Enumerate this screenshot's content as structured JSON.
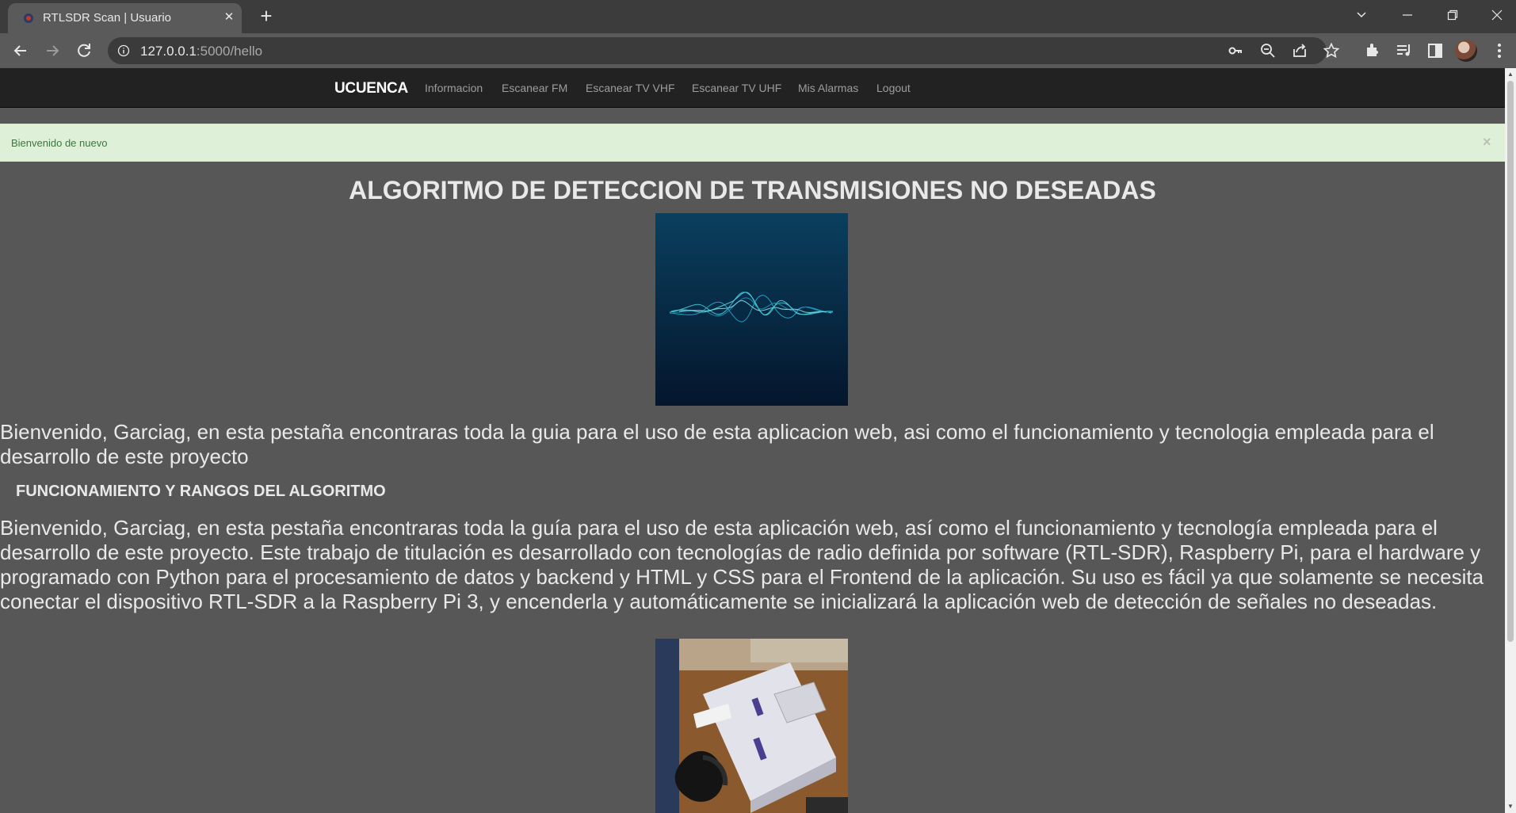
{
  "browser": {
    "tab_title": "RTLSDR Scan | Usuario",
    "url_host": "127.0.0.1",
    "url_rest": ":5000/hello"
  },
  "navbar": {
    "brand": "UCUENCA",
    "links": [
      "Informacion",
      "Escanear FM",
      "Escanear TV VHF",
      "Escanear TV UHF",
      "Mis Alarmas",
      "Logout"
    ]
  },
  "alert": {
    "text": "Bienvenido de nuevo",
    "close": "×"
  },
  "main": {
    "title": "ALGORITMO DE DETECCION DE TRANSMISIONES NO DESEADAS",
    "intro": "Bienvenido, Garciag, en esta pestaña encontraras toda la guia para el uso de esta aplicacion web, asi como el funcionamiento y tecnologia empleada para el desarrollo de este proyecto",
    "section_heading": "FUNCIONAMIENTO Y RANGOS DEL ALGORITMO",
    "body": "Bienvenido, Garciag, en esta pestaña encontraras toda la guía para el uso de esta aplicación web, así como el funcionamiento y tecnología empleada para el desarrollo de este proyecto. Este trabajo de titulación es desarrollado con tecnologías de radio definida por software (RTL-SDR), Raspberry Pi, para el hardware y programado con Python para el procesamiento de datos y backend y HTML y CSS para el Frontend de la aplicación. Su uso es fácil ya que solamente se necesita conectar el dispositivo RTL-SDR a la Raspberry Pi 3, y encenderla y automáticamente se inicializará la aplicación web de detección de señales no deseadas."
  },
  "colors": {
    "page_bg": "#575757",
    "navbar_bg": "#222222",
    "alert_bg": "#dff0d8",
    "alert_text": "#3c763d"
  }
}
